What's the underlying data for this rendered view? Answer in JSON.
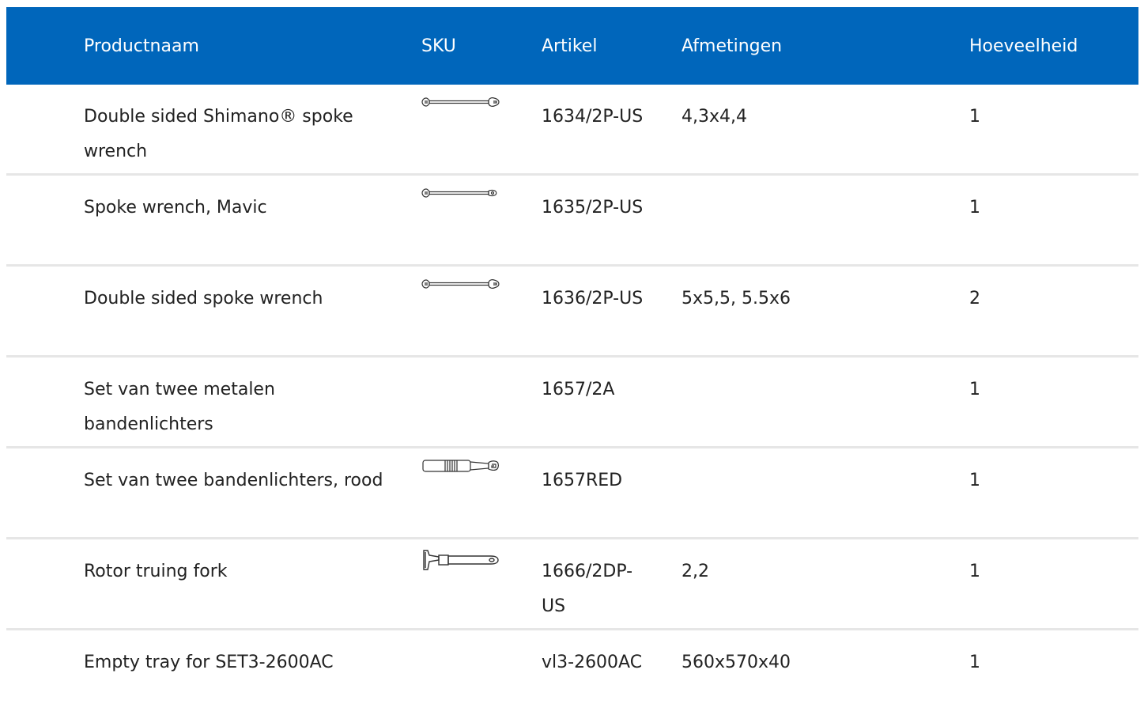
{
  "header": {
    "product_name": "Productnaam",
    "sku": "SKU",
    "article": "Artikel",
    "dimensions": "Afmetingen",
    "quantity": "Hoeveelheid"
  },
  "colors": {
    "header_bg": "#0066bb",
    "divider": "#e6e6e6"
  },
  "rows": [
    {
      "name": "Double sided Shimano® spoke wrench",
      "sku_icon": "double-spoke-wrench-icon",
      "article": "1634/2P-US",
      "dimensions": "4,3x4,4",
      "quantity": "1"
    },
    {
      "name": "Spoke wrench, Mavic",
      "sku_icon": "mavic-spoke-wrench-icon",
      "article": "1635/2P-US",
      "dimensions": "",
      "quantity": "1"
    },
    {
      "name": "Double sided spoke wrench",
      "sku_icon": "double-spoke-wrench-icon",
      "article": "1636/2P-US",
      "dimensions": "5x5,5, 5.5x6",
      "quantity": "2"
    },
    {
      "name": "Set van twee metalen bandenlichters",
      "sku_icon": "",
      "article": "1657/2A",
      "dimensions": "",
      "quantity": "1"
    },
    {
      "name": "Set van twee bandenlichters, rood",
      "sku_icon": "tire-lever-icon",
      "article": "1657RED",
      "dimensions": "",
      "quantity": "1"
    },
    {
      "name": "Rotor truing fork",
      "sku_icon": "rotor-truing-fork-icon",
      "article": "1666/2DP-US",
      "dimensions": "2,2",
      "quantity": "1"
    },
    {
      "name": "Empty tray for SET3-2600AC",
      "sku_icon": "",
      "article": "vl3-2600AC",
      "dimensions": "560x570x40",
      "quantity": "1"
    }
  ]
}
